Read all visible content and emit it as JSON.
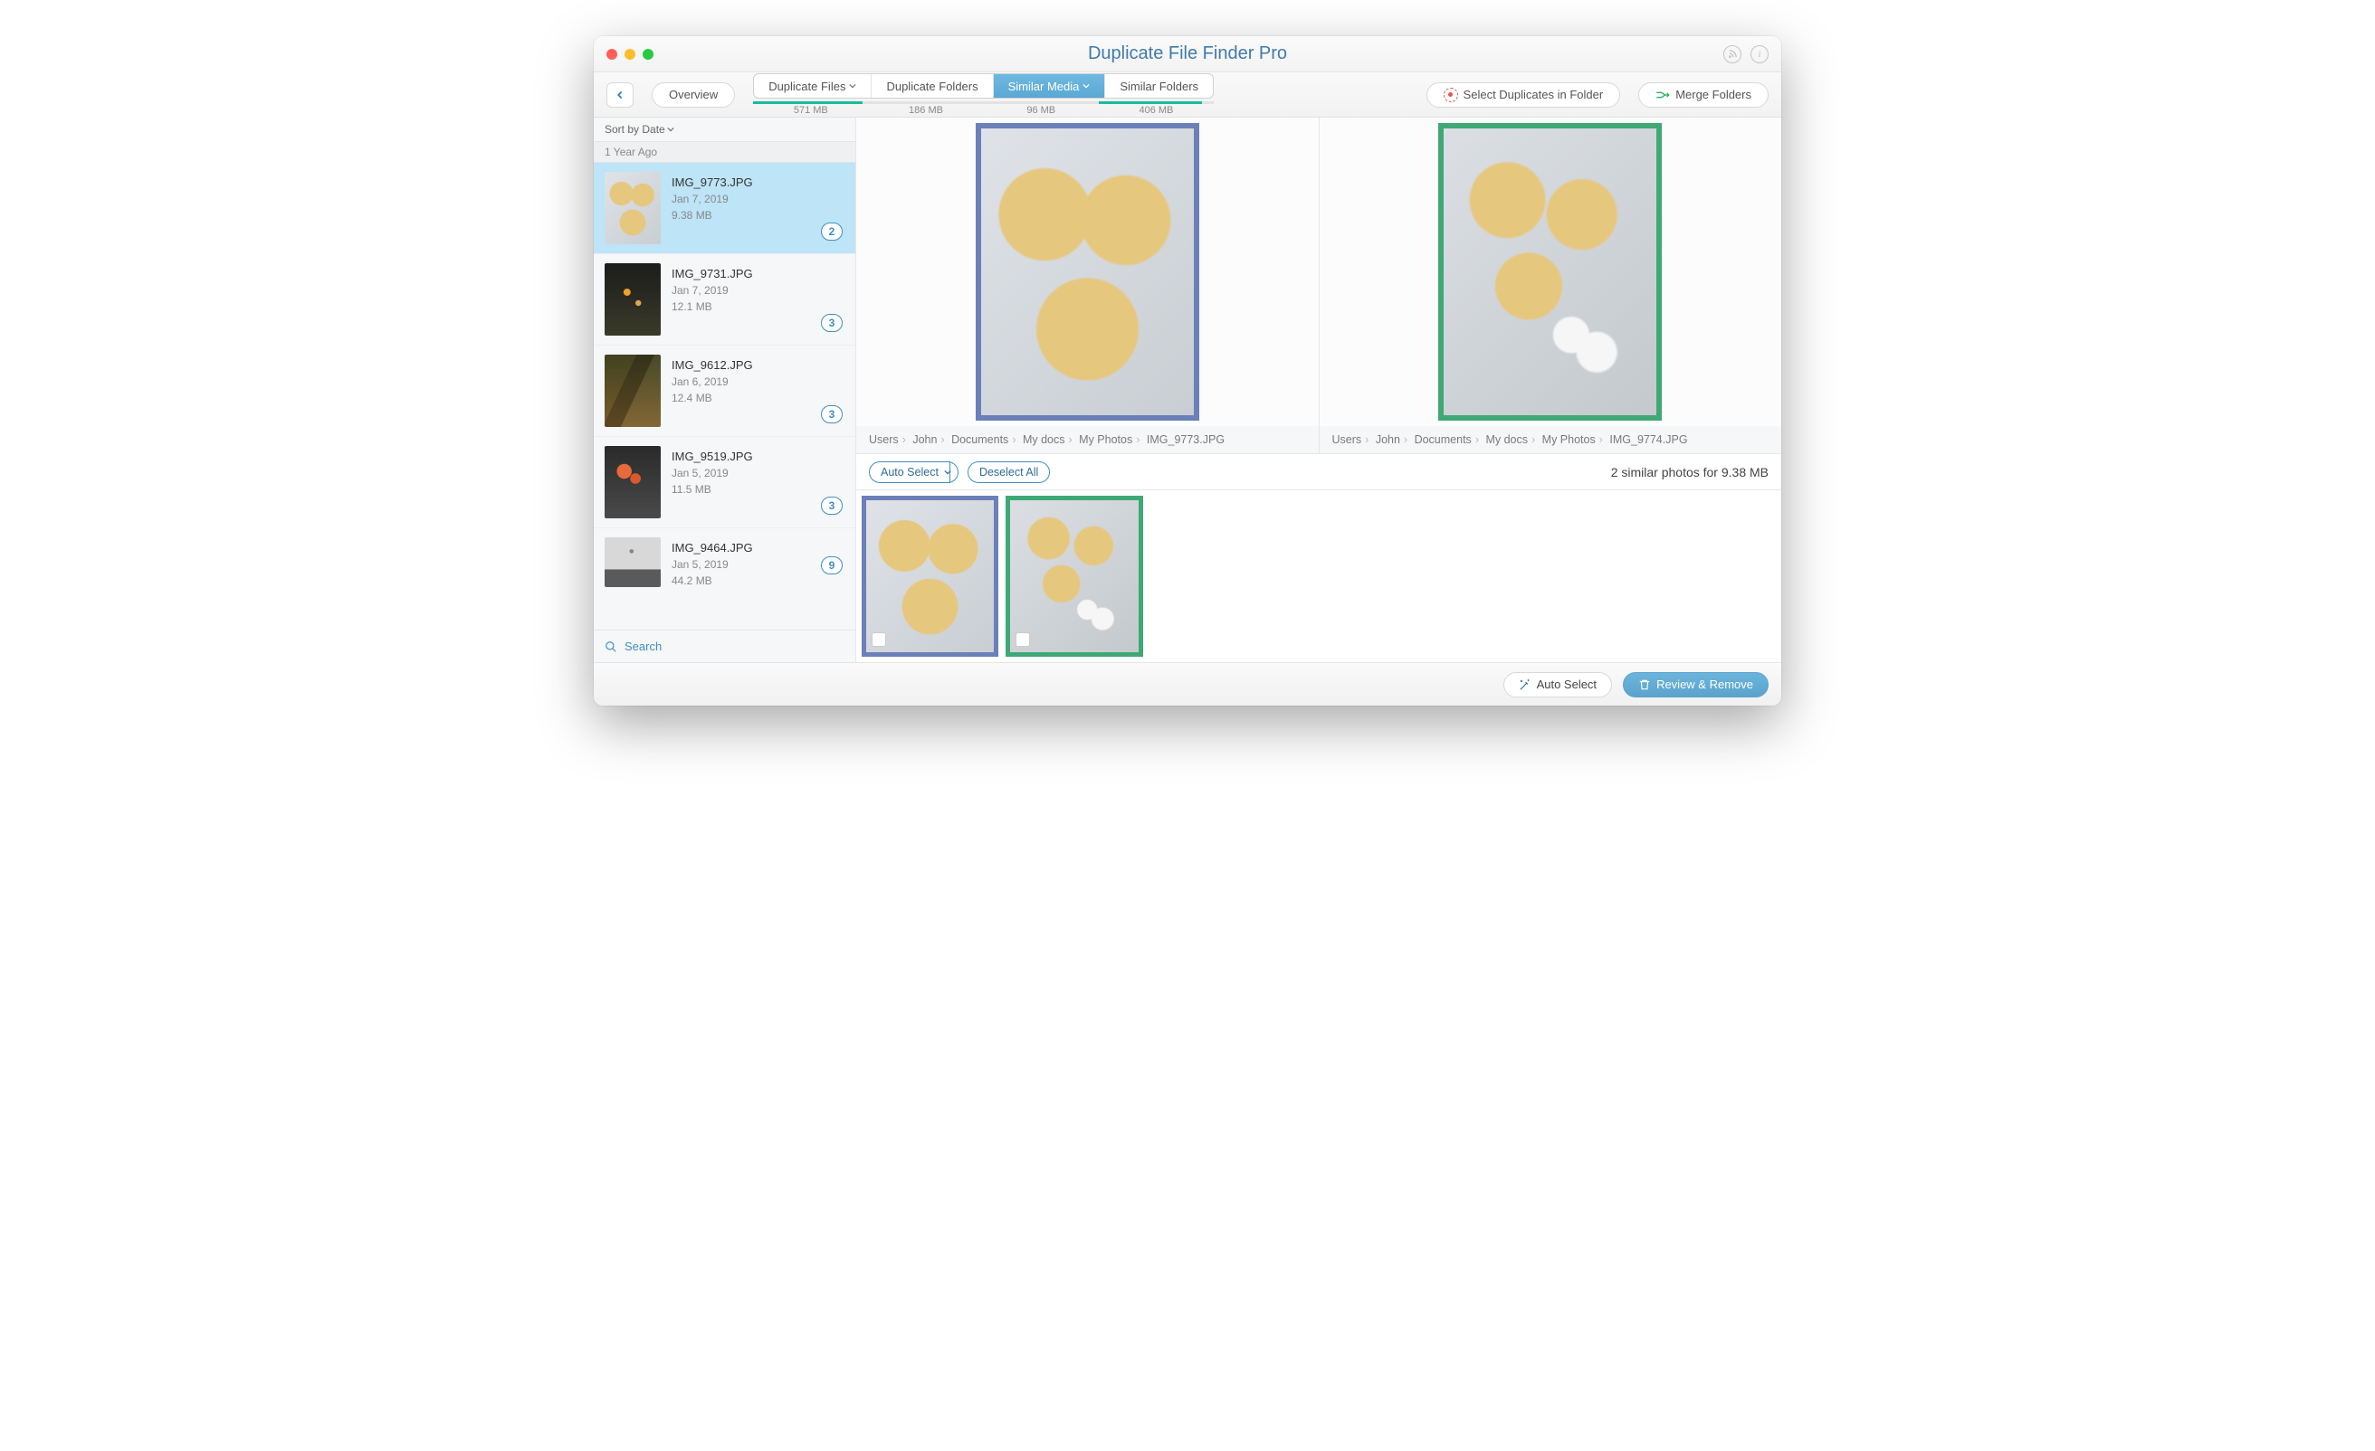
{
  "window": {
    "title": "Duplicate File Finder Pro"
  },
  "toolbar": {
    "overview": "Overview",
    "select_duplicates": "Select Duplicates in Folder",
    "merge_folders": "Merge Folders"
  },
  "tabs": [
    {
      "label": "Duplicate Files",
      "size": "571 MB",
      "fill": 95,
      "dropdown": true
    },
    {
      "label": "Duplicate Folders",
      "size": "186 MB",
      "fill": 0
    },
    {
      "label": "Similar Media",
      "size": "96 MB",
      "fill": 0,
      "dropdown": true,
      "active": true
    },
    {
      "label": "Similar Folders",
      "size": "406 MB",
      "fill": 90
    }
  ],
  "sidebar": {
    "sort_label": "Sort by Date",
    "group": "1 Year Ago",
    "search": "Search",
    "items": [
      {
        "name": "IMG_9773.JPG",
        "date": "Jan 7, 2019",
        "size": "9.38 MB",
        "count": "2",
        "thumb": "art1",
        "selected": true
      },
      {
        "name": "IMG_9731.JPG",
        "date": "Jan 7, 2019",
        "size": "12.1 MB",
        "count": "3",
        "thumb": "dark1"
      },
      {
        "name": "IMG_9612.JPG",
        "date": "Jan 6, 2019",
        "size": "12.4 MB",
        "count": "3",
        "thumb": "wheat"
      },
      {
        "name": "IMG_9519.JPG",
        "date": "Jan 5, 2019",
        "size": "11.5 MB",
        "count": "3",
        "thumb": "flower"
      },
      {
        "name": "IMG_9464.JPG",
        "date": "Jan 5, 2019",
        "size": "44.2 MB",
        "count": "9",
        "thumb": "tree"
      }
    ]
  },
  "preview": {
    "left_path": [
      "Users",
      "John",
      "Documents",
      "My docs",
      "My Photos",
      "IMG_9773.JPG"
    ],
    "right_path": [
      "Users",
      "John",
      "Documents",
      "My docs",
      "My Photos",
      "IMG_9774.JPG"
    ]
  },
  "actions": {
    "auto_select": "Auto Select",
    "deselect_all": "Deselect All",
    "summary": "2 similar photos for 9.38 MB"
  },
  "footer": {
    "auto_select": "Auto Select",
    "review_remove": "Review & Remove"
  }
}
